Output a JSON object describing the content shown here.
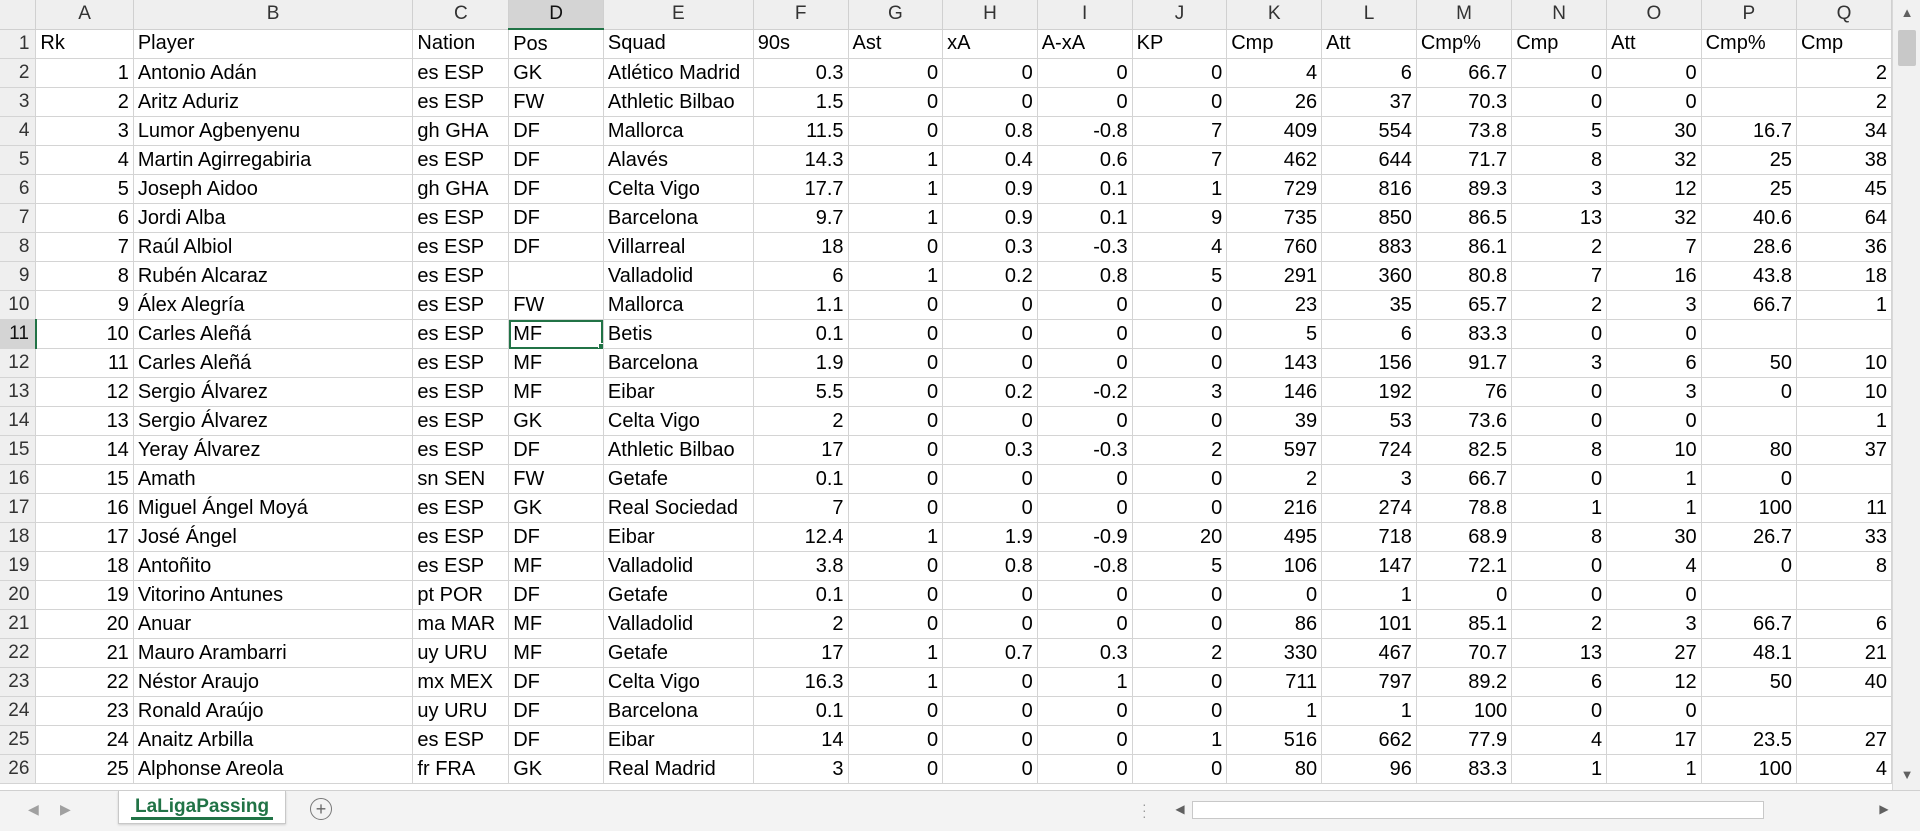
{
  "sheet": {
    "columns": [
      "A",
      "B",
      "C",
      "D",
      "E",
      "F",
      "G",
      "H",
      "I",
      "J",
      "K",
      "L",
      "M",
      "N",
      "O",
      "P",
      "Q"
    ],
    "selected_column": "D",
    "selected_row": 11,
    "rows": [
      {
        "n": "1",
        "cells": [
          "Rk",
          "Player",
          "Nation",
          "Pos",
          "Squad",
          "90s",
          "Ast",
          "xA",
          "A-xA",
          "KP",
          "Cmp",
          "Att",
          "Cmp%",
          "Cmp",
          "Att",
          "Cmp%",
          "Cmp"
        ]
      },
      {
        "n": "2",
        "cells": [
          "1",
          "Antonio Adán",
          "es ESP",
          "GK",
          "Atlético Madrid",
          "0.3",
          "0",
          "0",
          "0",
          "0",
          "4",
          "6",
          "66.7",
          "0",
          "0",
          "",
          "2"
        ]
      },
      {
        "n": "3",
        "cells": [
          "2",
          "Aritz Aduriz",
          "es ESP",
          "FW",
          "Athletic Bilbao",
          "1.5",
          "0",
          "0",
          "0",
          "0",
          "26",
          "37",
          "70.3",
          "0",
          "0",
          "",
          "2"
        ]
      },
      {
        "n": "4",
        "cells": [
          "3",
          "Lumor Agbenyenu",
          "gh GHA",
          "DF",
          "Mallorca",
          "11.5",
          "0",
          "0.8",
          "-0.8",
          "7",
          "409",
          "554",
          "73.8",
          "5",
          "30",
          "16.7",
          "34"
        ]
      },
      {
        "n": "5",
        "cells": [
          "4",
          "Martin Agirregabiria",
          "es ESP",
          "DF",
          "Alavés",
          "14.3",
          "1",
          "0.4",
          "0.6",
          "7",
          "462",
          "644",
          "71.7",
          "8",
          "32",
          "25",
          "38"
        ]
      },
      {
        "n": "6",
        "cells": [
          "5",
          "Joseph Aidoo",
          "gh GHA",
          "DF",
          "Celta Vigo",
          "17.7",
          "1",
          "0.9",
          "0.1",
          "1",
          "729",
          "816",
          "89.3",
          "3",
          "12",
          "25",
          "45"
        ]
      },
      {
        "n": "7",
        "cells": [
          "6",
          "Jordi Alba",
          "es ESP",
          "DF",
          "Barcelona",
          "9.7",
          "1",
          "0.9",
          "0.1",
          "9",
          "735",
          "850",
          "86.5",
          "13",
          "32",
          "40.6",
          "64"
        ]
      },
      {
        "n": "8",
        "cells": [
          "7",
          "Raúl Albiol",
          "es ESP",
          "DF",
          "Villarreal",
          "18",
          "0",
          "0.3",
          "-0.3",
          "4",
          "760",
          "883",
          "86.1",
          "2",
          "7",
          "28.6",
          "36"
        ]
      },
      {
        "n": "9",
        "cells": [
          "8",
          "Rubén Alcaraz",
          "es ESP",
          "",
          "Valladolid",
          "6",
          "1",
          "0.2",
          "0.8",
          "5",
          "291",
          "360",
          "80.8",
          "7",
          "16",
          "43.8",
          "18"
        ]
      },
      {
        "n": "10",
        "cells": [
          "9",
          "Álex Alegría",
          "es ESP",
          "FW",
          "Mallorca",
          "1.1",
          "0",
          "0",
          "0",
          "0",
          "23",
          "35",
          "65.7",
          "2",
          "3",
          "66.7",
          "1"
        ]
      },
      {
        "n": "11",
        "cells": [
          "10",
          "Carles Aleñá",
          "es ESP",
          "MF",
          "Betis",
          "0.1",
          "0",
          "0",
          "0",
          "0",
          "5",
          "6",
          "83.3",
          "0",
          "0",
          "",
          ""
        ]
      },
      {
        "n": "12",
        "cells": [
          "11",
          "Carles Aleñá",
          "es ESP",
          "MF",
          "Barcelona",
          "1.9",
          "0",
          "0",
          "0",
          "0",
          "143",
          "156",
          "91.7",
          "3",
          "6",
          "50",
          "10"
        ]
      },
      {
        "n": "13",
        "cells": [
          "12",
          "Sergio Álvarez",
          "es ESP",
          "MF",
          "Eibar",
          "5.5",
          "0",
          "0.2",
          "-0.2",
          "3",
          "146",
          "192",
          "76",
          "0",
          "3",
          "0",
          "10"
        ]
      },
      {
        "n": "14",
        "cells": [
          "13",
          "Sergio Álvarez",
          "es ESP",
          "GK",
          "Celta Vigo",
          "2",
          "0",
          "0",
          "0",
          "0",
          "39",
          "53",
          "73.6",
          "0",
          "0",
          "",
          "1"
        ]
      },
      {
        "n": "15",
        "cells": [
          "14",
          "Yeray Álvarez",
          "es ESP",
          "DF",
          "Athletic Bilbao",
          "17",
          "0",
          "0.3",
          "-0.3",
          "2",
          "597",
          "724",
          "82.5",
          "8",
          "10",
          "80",
          "37"
        ]
      },
      {
        "n": "16",
        "cells": [
          "15",
          "Amath",
          "sn SEN",
          "FW",
          "Getafe",
          "0.1",
          "0",
          "0",
          "0",
          "0",
          "2",
          "3",
          "66.7",
          "0",
          "1",
          "0",
          ""
        ]
      },
      {
        "n": "17",
        "cells": [
          "16",
          "Miguel Ángel Moyá",
          "es ESP",
          "GK",
          "Real Sociedad",
          "7",
          "0",
          "0",
          "0",
          "0",
          "216",
          "274",
          "78.8",
          "1",
          "1",
          "100",
          "11"
        ]
      },
      {
        "n": "18",
        "cells": [
          "17",
          "José Ángel",
          "es ESP",
          "DF",
          "Eibar",
          "12.4",
          "1",
          "1.9",
          "-0.9",
          "20",
          "495",
          "718",
          "68.9",
          "8",
          "30",
          "26.7",
          "33"
        ]
      },
      {
        "n": "19",
        "cells": [
          "18",
          "Antoñito",
          "es ESP",
          "MF",
          "Valladolid",
          "3.8",
          "0",
          "0.8",
          "-0.8",
          "5",
          "106",
          "147",
          "72.1",
          "0",
          "4",
          "0",
          "8"
        ]
      },
      {
        "n": "20",
        "cells": [
          "19",
          "Vitorino Antunes",
          "pt POR",
          "DF",
          "Getafe",
          "0.1",
          "0",
          "0",
          "0",
          "0",
          "0",
          "1",
          "0",
          "0",
          "0",
          "",
          ""
        ]
      },
      {
        "n": "21",
        "cells": [
          "20",
          "Anuar",
          "ma MAR",
          "MF",
          "Valladolid",
          "2",
          "0",
          "0",
          "0",
          "0",
          "86",
          "101",
          "85.1",
          "2",
          "3",
          "66.7",
          "6"
        ]
      },
      {
        "n": "22",
        "cells": [
          "21",
          "Mauro Arambarri",
          "uy URU",
          "MF",
          "Getafe",
          "17",
          "1",
          "0.7",
          "0.3",
          "2",
          "330",
          "467",
          "70.7",
          "13",
          "27",
          "48.1",
          "21"
        ]
      },
      {
        "n": "23",
        "cells": [
          "22",
          "Néstor Araujo",
          "mx MEX",
          "DF",
          "Celta Vigo",
          "16.3",
          "1",
          "0",
          "1",
          "0",
          "711",
          "797",
          "89.2",
          "6",
          "12",
          "50",
          "40"
        ]
      },
      {
        "n": "24",
        "cells": [
          "23",
          "Ronald Araújo",
          "uy URU",
          "DF",
          "Barcelona",
          "0.1",
          "0",
          "0",
          "0",
          "0",
          "1",
          "1",
          "100",
          "0",
          "0",
          "",
          ""
        ]
      },
      {
        "n": "25",
        "cells": [
          "24",
          "Anaitz Arbilla",
          "es ESP",
          "DF",
          "Eibar",
          "14",
          "0",
          "0",
          "0",
          "1",
          "516",
          "662",
          "77.9",
          "4",
          "17",
          "23.5",
          "27"
        ]
      },
      {
        "n": "26",
        "cells": [
          "25",
          "Alphonse Areola",
          "fr FRA",
          "GK",
          "Real Madrid",
          "3",
          "0",
          "0",
          "0",
          "0",
          "80",
          "96",
          "83.3",
          "1",
          "1",
          "100",
          "4"
        ]
      }
    ]
  },
  "tabs": {
    "active_sheet": "LaLigaPassing",
    "add_sheet_icon": "plus-circle-icon"
  },
  "colors": {
    "accent": "#217346",
    "header_bg": "#efefef",
    "grid_line": "#d4d4d4"
  }
}
